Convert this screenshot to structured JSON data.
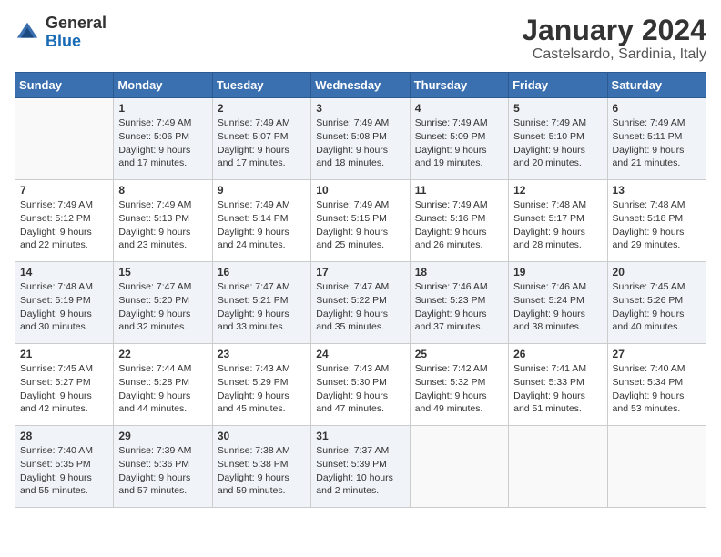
{
  "logo": {
    "general": "General",
    "blue": "Blue"
  },
  "title": "January 2024",
  "subtitle": "Castelsardo, Sardinia, Italy",
  "header_days": [
    "Sunday",
    "Monday",
    "Tuesday",
    "Wednesday",
    "Thursday",
    "Friday",
    "Saturday"
  ],
  "weeks": [
    [
      {
        "day": "",
        "sunrise": "",
        "sunset": "",
        "daylight": ""
      },
      {
        "day": "1",
        "sunrise": "Sunrise: 7:49 AM",
        "sunset": "Sunset: 5:06 PM",
        "daylight": "Daylight: 9 hours and 17 minutes."
      },
      {
        "day": "2",
        "sunrise": "Sunrise: 7:49 AM",
        "sunset": "Sunset: 5:07 PM",
        "daylight": "Daylight: 9 hours and 17 minutes."
      },
      {
        "day": "3",
        "sunrise": "Sunrise: 7:49 AM",
        "sunset": "Sunset: 5:08 PM",
        "daylight": "Daylight: 9 hours and 18 minutes."
      },
      {
        "day": "4",
        "sunrise": "Sunrise: 7:49 AM",
        "sunset": "Sunset: 5:09 PM",
        "daylight": "Daylight: 9 hours and 19 minutes."
      },
      {
        "day": "5",
        "sunrise": "Sunrise: 7:49 AM",
        "sunset": "Sunset: 5:10 PM",
        "daylight": "Daylight: 9 hours and 20 minutes."
      },
      {
        "day": "6",
        "sunrise": "Sunrise: 7:49 AM",
        "sunset": "Sunset: 5:11 PM",
        "daylight": "Daylight: 9 hours and 21 minutes."
      }
    ],
    [
      {
        "day": "7",
        "sunrise": "Sunrise: 7:49 AM",
        "sunset": "Sunset: 5:12 PM",
        "daylight": "Daylight: 9 hours and 22 minutes."
      },
      {
        "day": "8",
        "sunrise": "Sunrise: 7:49 AM",
        "sunset": "Sunset: 5:13 PM",
        "daylight": "Daylight: 9 hours and 23 minutes."
      },
      {
        "day": "9",
        "sunrise": "Sunrise: 7:49 AM",
        "sunset": "Sunset: 5:14 PM",
        "daylight": "Daylight: 9 hours and 24 minutes."
      },
      {
        "day": "10",
        "sunrise": "Sunrise: 7:49 AM",
        "sunset": "Sunset: 5:15 PM",
        "daylight": "Daylight: 9 hours and 25 minutes."
      },
      {
        "day": "11",
        "sunrise": "Sunrise: 7:49 AM",
        "sunset": "Sunset: 5:16 PM",
        "daylight": "Daylight: 9 hours and 26 minutes."
      },
      {
        "day": "12",
        "sunrise": "Sunrise: 7:48 AM",
        "sunset": "Sunset: 5:17 PM",
        "daylight": "Daylight: 9 hours and 28 minutes."
      },
      {
        "day": "13",
        "sunrise": "Sunrise: 7:48 AM",
        "sunset": "Sunset: 5:18 PM",
        "daylight": "Daylight: 9 hours and 29 minutes."
      }
    ],
    [
      {
        "day": "14",
        "sunrise": "Sunrise: 7:48 AM",
        "sunset": "Sunset: 5:19 PM",
        "daylight": "Daylight: 9 hours and 30 minutes."
      },
      {
        "day": "15",
        "sunrise": "Sunrise: 7:47 AM",
        "sunset": "Sunset: 5:20 PM",
        "daylight": "Daylight: 9 hours and 32 minutes."
      },
      {
        "day": "16",
        "sunrise": "Sunrise: 7:47 AM",
        "sunset": "Sunset: 5:21 PM",
        "daylight": "Daylight: 9 hours and 33 minutes."
      },
      {
        "day": "17",
        "sunrise": "Sunrise: 7:47 AM",
        "sunset": "Sunset: 5:22 PM",
        "daylight": "Daylight: 9 hours and 35 minutes."
      },
      {
        "day": "18",
        "sunrise": "Sunrise: 7:46 AM",
        "sunset": "Sunset: 5:23 PM",
        "daylight": "Daylight: 9 hours and 37 minutes."
      },
      {
        "day": "19",
        "sunrise": "Sunrise: 7:46 AM",
        "sunset": "Sunset: 5:24 PM",
        "daylight": "Daylight: 9 hours and 38 minutes."
      },
      {
        "day": "20",
        "sunrise": "Sunrise: 7:45 AM",
        "sunset": "Sunset: 5:26 PM",
        "daylight": "Daylight: 9 hours and 40 minutes."
      }
    ],
    [
      {
        "day": "21",
        "sunrise": "Sunrise: 7:45 AM",
        "sunset": "Sunset: 5:27 PM",
        "daylight": "Daylight: 9 hours and 42 minutes."
      },
      {
        "day": "22",
        "sunrise": "Sunrise: 7:44 AM",
        "sunset": "Sunset: 5:28 PM",
        "daylight": "Daylight: 9 hours and 44 minutes."
      },
      {
        "day": "23",
        "sunrise": "Sunrise: 7:43 AM",
        "sunset": "Sunset: 5:29 PM",
        "daylight": "Daylight: 9 hours and 45 minutes."
      },
      {
        "day": "24",
        "sunrise": "Sunrise: 7:43 AM",
        "sunset": "Sunset: 5:30 PM",
        "daylight": "Daylight: 9 hours and 47 minutes."
      },
      {
        "day": "25",
        "sunrise": "Sunrise: 7:42 AM",
        "sunset": "Sunset: 5:32 PM",
        "daylight": "Daylight: 9 hours and 49 minutes."
      },
      {
        "day": "26",
        "sunrise": "Sunrise: 7:41 AM",
        "sunset": "Sunset: 5:33 PM",
        "daylight": "Daylight: 9 hours and 51 minutes."
      },
      {
        "day": "27",
        "sunrise": "Sunrise: 7:40 AM",
        "sunset": "Sunset: 5:34 PM",
        "daylight": "Daylight: 9 hours and 53 minutes."
      }
    ],
    [
      {
        "day": "28",
        "sunrise": "Sunrise: 7:40 AM",
        "sunset": "Sunset: 5:35 PM",
        "daylight": "Daylight: 9 hours and 55 minutes."
      },
      {
        "day": "29",
        "sunrise": "Sunrise: 7:39 AM",
        "sunset": "Sunset: 5:36 PM",
        "daylight": "Daylight: 9 hours and 57 minutes."
      },
      {
        "day": "30",
        "sunrise": "Sunrise: 7:38 AM",
        "sunset": "Sunset: 5:38 PM",
        "daylight": "Daylight: 9 hours and 59 minutes."
      },
      {
        "day": "31",
        "sunrise": "Sunrise: 7:37 AM",
        "sunset": "Sunset: 5:39 PM",
        "daylight": "Daylight: 10 hours and 2 minutes."
      },
      {
        "day": "",
        "sunrise": "",
        "sunset": "",
        "daylight": ""
      },
      {
        "day": "",
        "sunrise": "",
        "sunset": "",
        "daylight": ""
      },
      {
        "day": "",
        "sunrise": "",
        "sunset": "",
        "daylight": ""
      }
    ]
  ]
}
